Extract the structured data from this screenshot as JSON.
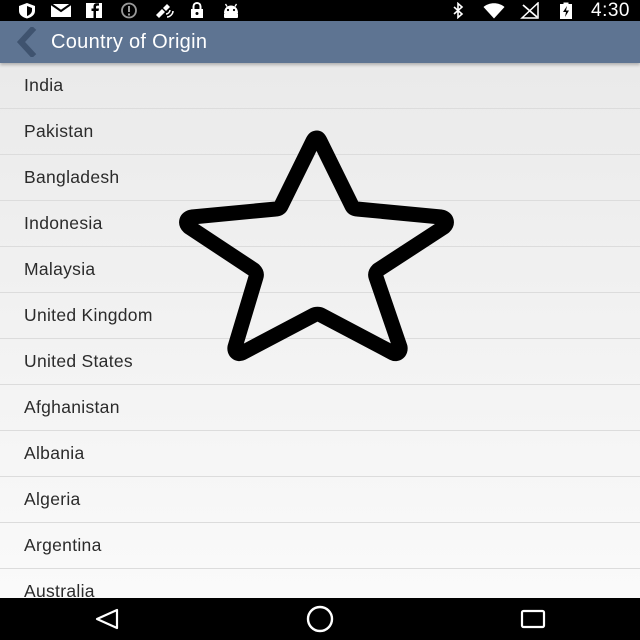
{
  "status_bar": {
    "left_icons": [
      "shield-icon",
      "mail-icon",
      "facebook-icon",
      "info-icon",
      "satellite-icon",
      "lock-icon",
      "android-icon"
    ],
    "right_icons": [
      "bluetooth-icon",
      "wifi-icon",
      "no-signal-icon",
      "battery-charging-icon"
    ],
    "time": "4:30"
  },
  "action_bar": {
    "title": "Country of Origin",
    "back_icon": "chevron-left-icon",
    "color": "#5e7492"
  },
  "countries": [
    "India",
    "Pakistan",
    "Bangladesh",
    "Indonesia",
    "Malaysia",
    "United Kingdom",
    "United States",
    "Afghanistan",
    "Albania",
    "Algeria",
    "Argentina",
    "Australia"
  ],
  "overlay": {
    "icon": "star-outline-icon"
  },
  "nav_bar": {
    "buttons": [
      "back-triangle-icon",
      "home-circle-icon",
      "recents-square-icon"
    ]
  }
}
